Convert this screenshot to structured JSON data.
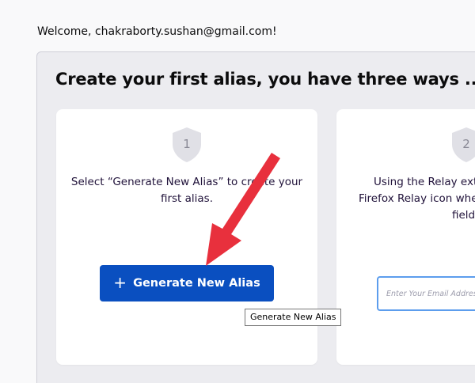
{
  "welcome": "Welcome, chakraborty.sushan@gmail.com!",
  "panel": {
    "title": "Create your first alias, you have three ways ..."
  },
  "cards": [
    {
      "number": "1",
      "text_lines": [
        "Select “Generate New Alias” to create your",
        "first alias."
      ],
      "button_label": "Generate New Alias",
      "button_icon": "plus-icon"
    },
    {
      "number": "2",
      "text_lines": [
        "Using the Relay exte",
        "Firefox Relay icon whe",
        "fields"
      ],
      "input_placeholder": "Enter Your Email Addres"
    }
  ],
  "tooltip": "Generate New Alias",
  "colors": {
    "button": "#0a4fc0",
    "arrow": "#e8303d",
    "shield": "#e0e0e6",
    "input_border": "#5c9ded"
  }
}
